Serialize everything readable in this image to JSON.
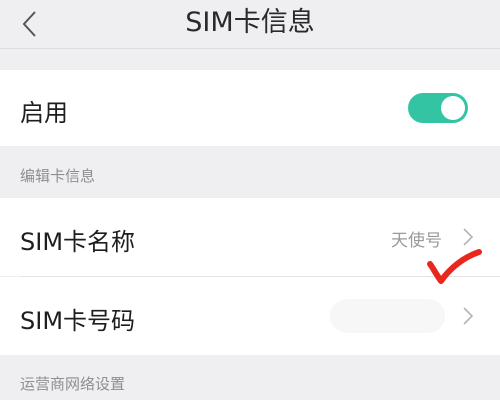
{
  "header": {
    "title": "SIM卡信息",
    "back_icon": "chevron-left-icon"
  },
  "enable": {
    "label": "启用",
    "enabled": true,
    "toggle_color": "#33c5a3"
  },
  "sections": {
    "edit_card_info": "编辑卡信息",
    "carrier_network": "运营商网络设置"
  },
  "sim_name": {
    "label": "SIM卡名称",
    "value": "天使号",
    "chevron_icon": "chevron-right-icon"
  },
  "sim_number": {
    "label": "SIM卡号码",
    "chevron_icon": "chevron-right-icon"
  },
  "annotation": {
    "icon": "red-check-mark-icon",
    "color": "#e8281c"
  }
}
